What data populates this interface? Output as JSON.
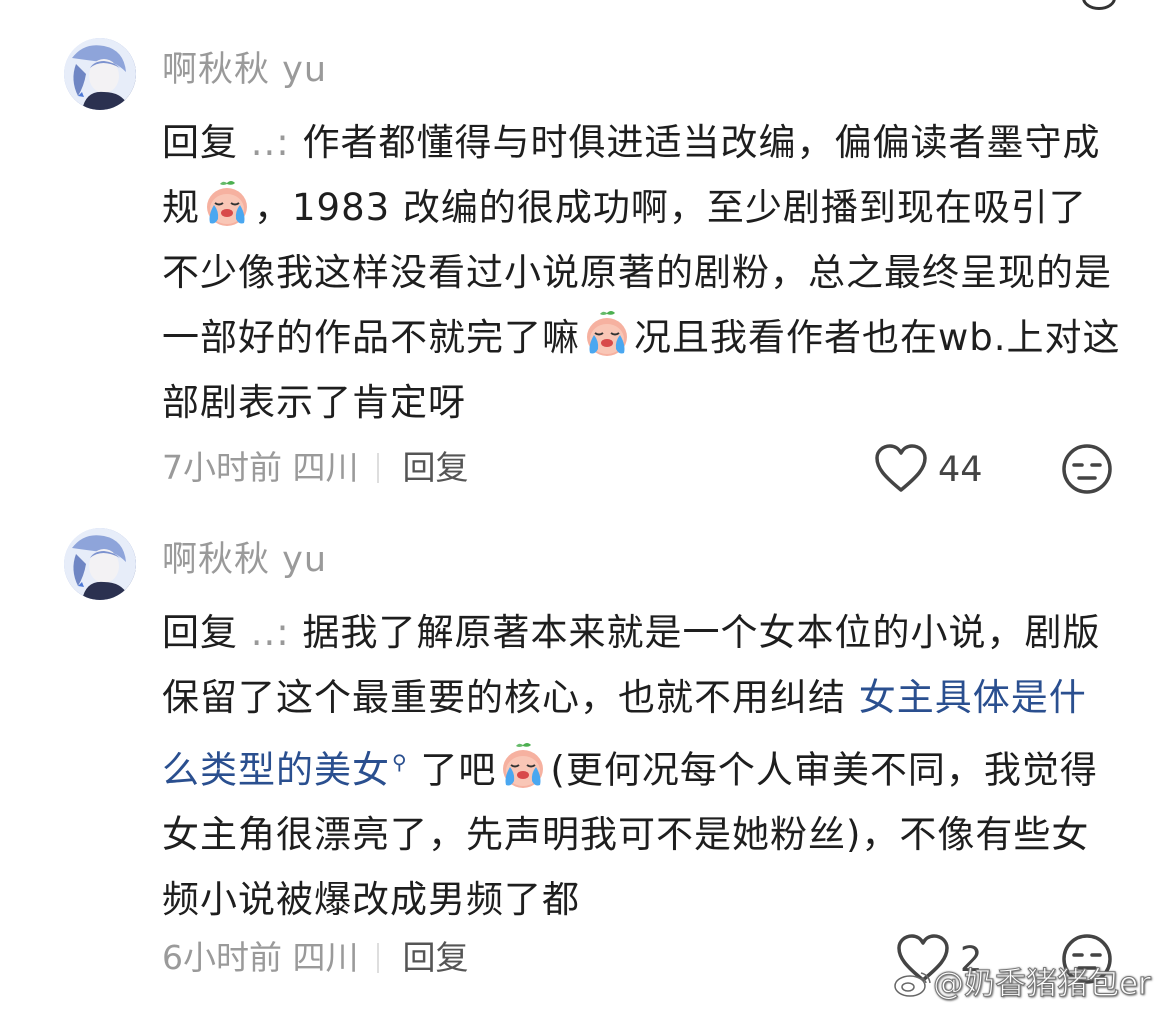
{
  "comments": [
    {
      "username": "啊秋秋 yu",
      "reply_label": "回复",
      "reply_target": " ..: ",
      "text_1": "作者都懂得与时俱进适当改编，偏偏读者墨守成规",
      "text_2": "，1983 改编的很成功啊，至少剧播到现在吸引了不少像我这样没看过小说原著的剧粉，总之最终呈现的是一部好的作品不就完了嘛",
      "text_3": "况且我看作者也在wb.上对这部剧表示了肯定呀",
      "time": "7小时前",
      "location": "四川",
      "reply_button": "回复",
      "likes": "44"
    },
    {
      "username": "啊秋秋 yu",
      "reply_label": "回复",
      "reply_target": " ..: ",
      "text_1": "据我了解原著本来就是一个女本位的小说，剧版保留了这个最重要的核心，也就不用纠结 ",
      "link_text": "女主具体是什么类型的美女",
      "text_2": " 了吧",
      "text_3": "(更何况每个人审美不同，我觉得女主角很漂亮了，先声明我可不是她粉丝)，不像有些女频小说被爆改成男频了都",
      "time": "6小时前",
      "location": "四川",
      "reply_button": "回复",
      "likes": "2"
    }
  ],
  "icons": {
    "emoji": "crying-face-emoji",
    "like": "heart-icon",
    "dislike": "unamused-face-icon",
    "search": "search-icon"
  },
  "colors": {
    "username": "#9a9a9a",
    "link": "#2a4f8f",
    "meta": "#9a9a9a"
  },
  "watermark": "@奶香猪猪包er"
}
